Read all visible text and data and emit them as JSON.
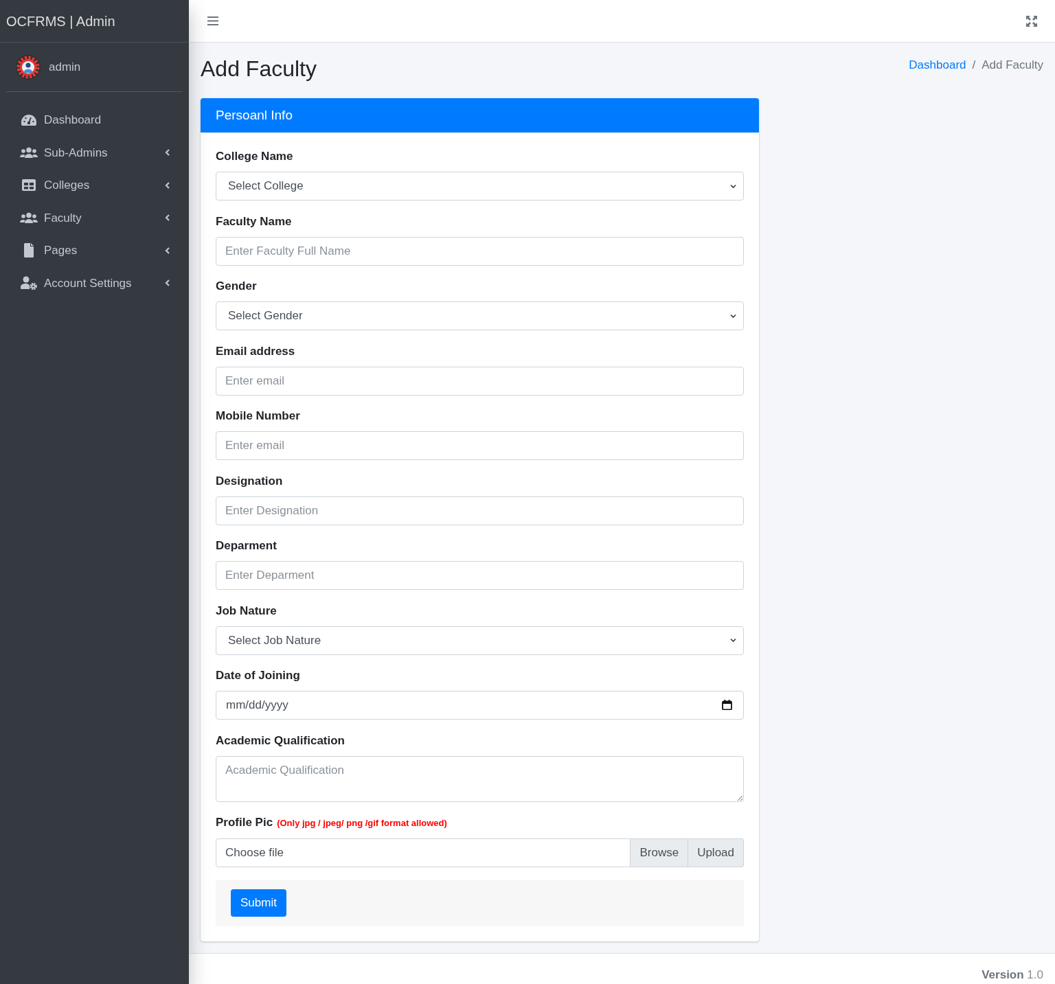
{
  "sidebar": {
    "brand": "OCFRMS | Admin",
    "user": "admin",
    "items": [
      {
        "label": "Dashboard",
        "submenu": false,
        "selected": false
      },
      {
        "label": "Sub-Admins",
        "submenu": true,
        "selected": false
      },
      {
        "label": "Colleges",
        "submenu": true,
        "selected": false
      },
      {
        "label": "Faculty",
        "submenu": true,
        "selected": false
      },
      {
        "label": "Pages",
        "submenu": true,
        "selected": false
      },
      {
        "label": "Account Settings",
        "submenu": true,
        "selected": false
      }
    ]
  },
  "page": {
    "title": "Add Faculty",
    "breadcrumb": {
      "separator": "/",
      "items": [
        {
          "label": "Dashboard",
          "link": true
        },
        {
          "label": "Add Faculty",
          "link": false
        }
      ]
    }
  },
  "card": {
    "title": "Persoanl Info",
    "fields": [
      {
        "label": "College Name",
        "kind": "select",
        "value": "Select College"
      },
      {
        "label": "Faculty Name",
        "kind": "text",
        "placeholder": "Enter Faculty Full Name"
      },
      {
        "label": "Gender",
        "kind": "select",
        "value": "Select Gender"
      },
      {
        "label": "Email address",
        "kind": "text",
        "placeholder": "Enter email"
      },
      {
        "label": "Mobile Number",
        "kind": "text",
        "placeholder": "Enter email"
      },
      {
        "label": "Designation",
        "kind": "text",
        "placeholder": "Enter Designation"
      },
      {
        "label": "Deparment",
        "kind": "text",
        "placeholder": "Enter Deparment"
      },
      {
        "label": "Job Nature",
        "kind": "select",
        "value": "Select Job Nature"
      },
      {
        "label": "Date of Joining",
        "kind": "date",
        "placeholder": "mm/dd/yyyy"
      },
      {
        "label": "Academic Qualification",
        "kind": "textarea",
        "placeholder": "Academic Qualification"
      },
      {
        "label": "Profile Pic",
        "note": "(Only jpg / jpeg/ png /gif format allowed)",
        "kind": "file",
        "placeholder": "Choose file",
        "browse": "Browse",
        "button": "Upload"
      }
    ],
    "submit": "Submit"
  },
  "footer": {
    "version": "**Version** 1.0"
  }
}
